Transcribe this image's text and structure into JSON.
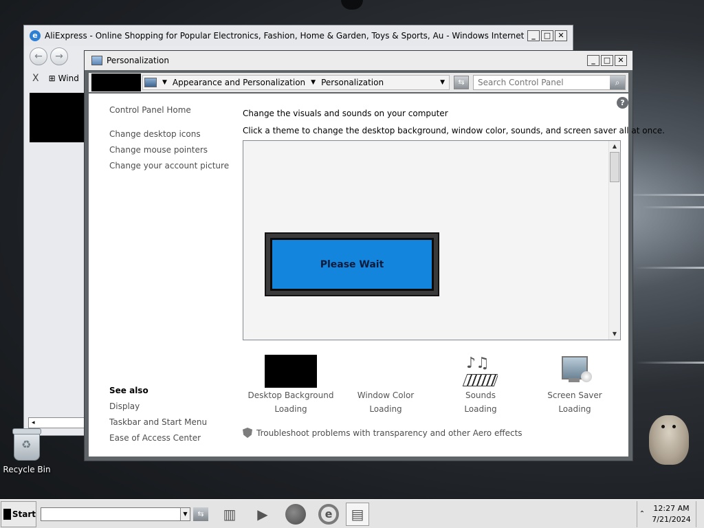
{
  "ie_window": {
    "title": "AliExpress - Online Shopping for Popular Electronics, Fashion, Home & Garden, Toys & Sports, Au - Windows Internet Explorer",
    "tab_close": "X",
    "tab_label": "Wind"
  },
  "personalization": {
    "title": "Personalization",
    "breadcrumb": [
      "Appearance and Personalization",
      "Personalization"
    ],
    "search_placeholder": "Search Control Panel",
    "left_links": [
      "Control Panel Home",
      "Change desktop icons",
      "Change mouse pointers",
      "Change your account picture"
    ],
    "see_also_title": "See also",
    "see_also_links": [
      "Display",
      "Taskbar and Start Menu",
      "Ease of Access Center"
    ],
    "heading": "Change the visuals and sounds on your computer",
    "subheading": "Click a theme to change the desktop background, window color, sounds, and screen saver all at once.",
    "wait_label": "Please Wait",
    "tiles": [
      {
        "label": "Desktop Background",
        "status": "Loading"
      },
      {
        "label": "Window Color",
        "status": "Loading"
      },
      {
        "label": "Sounds",
        "status": "Loading"
      },
      {
        "label": "Screen Saver",
        "status": "Loading"
      }
    ],
    "aero_link": "Troubleshoot problems with transparency and other Aero effects"
  },
  "desktop": {
    "recycle_bin": "Recycle Bin"
  },
  "taskbar": {
    "start_label": "Start",
    "time": "12:27 AM",
    "date": "7/21/2024"
  }
}
